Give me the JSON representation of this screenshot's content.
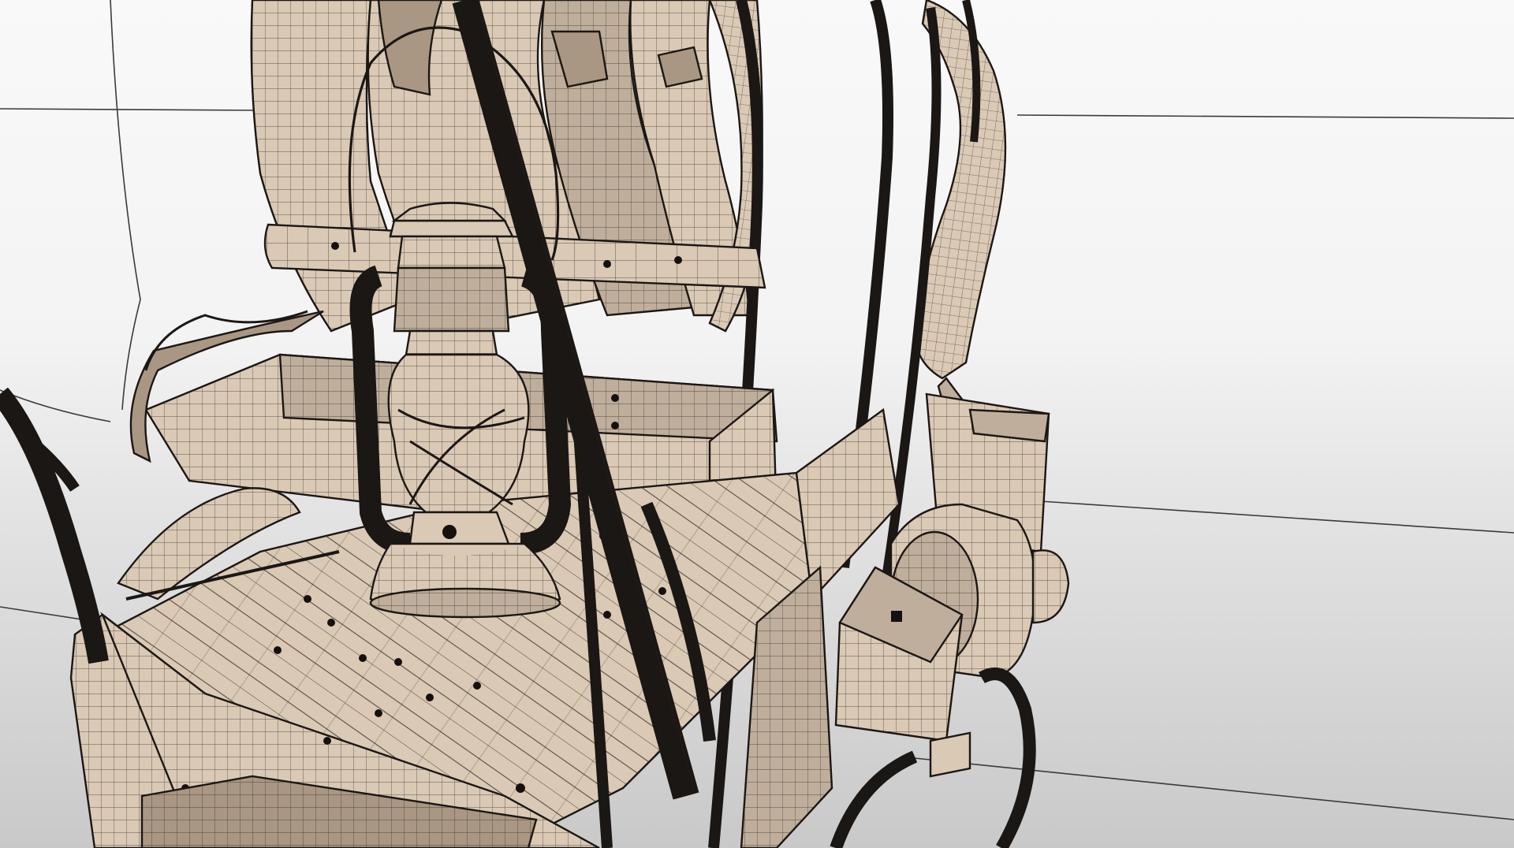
{
  "scene": {
    "subject": "covered-wagon-wireframe",
    "colors": {
      "material": "#dac9b5",
      "material_dark": "#bfae9b",
      "material_shade": "#a99783",
      "wire": "#1b1714",
      "background_top": "#f9f9f9",
      "background_bottom": "#c9c9c9"
    }
  }
}
